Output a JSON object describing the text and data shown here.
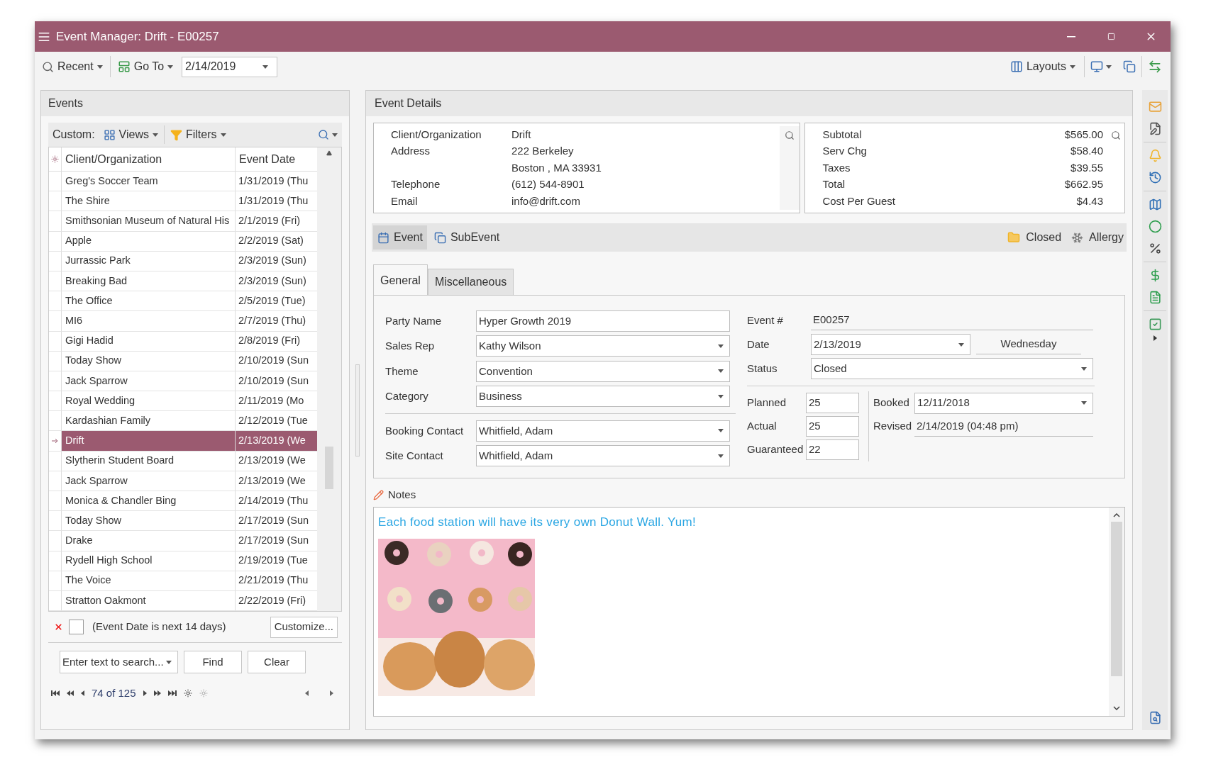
{
  "window": {
    "title": "Event Manager: Drift - E00257"
  },
  "toolbar": {
    "recent": "Recent",
    "goto": "Go To",
    "date": "2/14/2019",
    "layouts": "Layouts"
  },
  "events": {
    "title": "Events",
    "custom_label": "Custom:",
    "views": "Views",
    "filters": "Filters",
    "columns": [
      "Client/Organization",
      "Event Date"
    ],
    "rows": [
      {
        "client": "Greg's Soccer Team",
        "date": "1/31/2019 (Thu",
        "selected": false
      },
      {
        "client": "The Shire",
        "date": "1/31/2019 (Thu",
        "selected": false
      },
      {
        "client": "Smithsonian Museum of Natural His",
        "date": "2/1/2019 (Fri)",
        "selected": false
      },
      {
        "client": "Apple",
        "date": "2/2/2019 (Sat)",
        "selected": false
      },
      {
        "client": "Jurrassic Park",
        "date": "2/3/2019 (Sun)",
        "selected": false
      },
      {
        "client": "Breaking Bad",
        "date": "2/3/2019 (Sun)",
        "selected": false
      },
      {
        "client": "The Office",
        "date": "2/5/2019 (Tue)",
        "selected": false
      },
      {
        "client": "MI6",
        "date": "2/7/2019 (Thu)",
        "selected": false
      },
      {
        "client": "Gigi Hadid",
        "date": "2/8/2019 (Fri)",
        "selected": false
      },
      {
        "client": "Today Show",
        "date": "2/10/2019 (Sun",
        "selected": false
      },
      {
        "client": "Jack Sparrow",
        "date": "2/10/2019 (Sun",
        "selected": false
      },
      {
        "client": "Royal Wedding",
        "date": "2/11/2019 (Mo",
        "selected": false
      },
      {
        "client": "Kardashian Family",
        "date": "2/12/2019 (Tue",
        "selected": false
      },
      {
        "client": "Drift",
        "date": "2/13/2019 (We",
        "selected": true
      },
      {
        "client": "Slytherin Student Board",
        "date": "2/13/2019 (We",
        "selected": false
      },
      {
        "client": "Jack Sparrow",
        "date": "2/13/2019 (We",
        "selected": false
      },
      {
        "client": "Monica & Chandler Bing",
        "date": "2/14/2019 (Thu",
        "selected": false
      },
      {
        "client": "Today Show",
        "date": "2/17/2019 (Sun",
        "selected": false
      },
      {
        "client": "Drake",
        "date": "2/17/2019 (Sun",
        "selected": false
      },
      {
        "client": "Rydell High School",
        "date": "2/19/2019 (Tue",
        "selected": false
      },
      {
        "client": "The Voice",
        "date": "2/21/2019 (Thu",
        "selected": false
      },
      {
        "client": "Stratton Oakmont",
        "date": "2/22/2019 (Fri)",
        "selected": false
      }
    ],
    "filter": {
      "text": "(Event Date is next 14 days)",
      "checked": false,
      "customize": "Customize..."
    },
    "search": {
      "placeholder": "Enter text to search...",
      "find": "Find",
      "clear": "Clear"
    },
    "pager": {
      "position": "74 of 125"
    }
  },
  "details": {
    "title": "Event Details",
    "client_info": [
      {
        "label": "Client/Organization",
        "value": "Drift"
      },
      {
        "label": "Address",
        "value": "222 Berkeley"
      },
      {
        "value": "Boston , MA 33931"
      },
      {
        "label": "Telephone",
        "value": "(612) 544-8901"
      },
      {
        "label": "Email",
        "value": "info@drift.com"
      }
    ],
    "totals": [
      {
        "label": "Subtotal",
        "value": "$565.00"
      },
      {
        "label": "Serv Chg",
        "value": "$58.40"
      },
      {
        "label": "Taxes",
        "value": "$39.55"
      },
      {
        "label": "Total",
        "value": "$662.95"
      },
      {
        "label": "Cost Per Guest",
        "value": "$4.43"
      }
    ],
    "view_tabs": [
      {
        "label": "Event",
        "selected": true
      },
      {
        "label": "SubEvent",
        "selected": false
      }
    ],
    "status_flags": [
      "Closed",
      "Allergy"
    ],
    "form_tabs": [
      {
        "label": "General",
        "selected": true
      },
      {
        "label": "Miscellaneous",
        "selected": false
      }
    ],
    "left_fields": [
      {
        "label": "Party Name",
        "value": "Hyper Growth 2019",
        "kind": "text"
      },
      {
        "label": "Sales Rep",
        "value": "Kathy Wilson",
        "kind": "dropdown"
      },
      {
        "label": "Theme",
        "value": "Convention",
        "kind": "dropdown"
      },
      {
        "label": "Category",
        "value": "Business",
        "kind": "dropdown"
      },
      {
        "label": "Booking Contact",
        "value": "Whitfield, Adam",
        "kind": "dropdown"
      },
      {
        "label": "Site Contact",
        "value": "Whitfield, Adam",
        "kind": "dropdown"
      }
    ],
    "event_number": {
      "label": "Event #",
      "value": "E00257"
    },
    "date": {
      "label": "Date",
      "value": "2/13/2019",
      "weekday": "Wednesday"
    },
    "status": {
      "label": "Status",
      "value": "Closed"
    },
    "counts": [
      {
        "label": "Planned",
        "value": "25"
      },
      {
        "label": "Actual",
        "value": "25"
      },
      {
        "label": "Guaranteed",
        "value": "22"
      }
    ],
    "booked": {
      "label": "Booked",
      "value": "12/11/2018"
    },
    "revised": {
      "label": "Revised",
      "value": "2/14/2019 (04:48 pm)"
    },
    "notes": {
      "title": "Notes",
      "text": "Each food station will have its very own Donut Wall. Yum!"
    }
  }
}
